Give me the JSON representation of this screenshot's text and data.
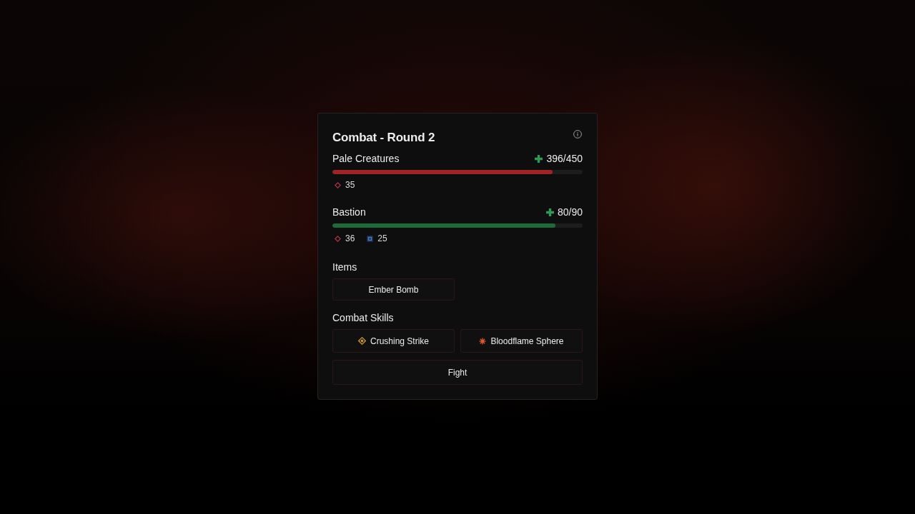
{
  "panel": {
    "title": "Combat - Round 2"
  },
  "combatants": [
    {
      "name": "Pale Creatures",
      "health": "396/450",
      "level": 0.88,
      "color": "#a12325",
      "stats": [
        {
          "kind": "attack",
          "value": "35"
        }
      ]
    },
    {
      "name": "Bastion",
      "health": "80/90",
      "level": 0.89,
      "color": "#1e6b39",
      "stats": [
        {
          "kind": "attack",
          "value": "36"
        },
        {
          "kind": "defense",
          "value": "25"
        }
      ]
    }
  ],
  "items": {
    "heading": "Items",
    "buttons": [
      {
        "label": "Ember Bomb"
      }
    ]
  },
  "skills": {
    "heading": "Combat Skills",
    "buttons": [
      {
        "label": "Crushing Strike",
        "kind": "diamond"
      },
      {
        "label": "Bloodflame Sphere",
        "kind": "burst"
      }
    ]
  },
  "action": {
    "label": "Fight"
  }
}
